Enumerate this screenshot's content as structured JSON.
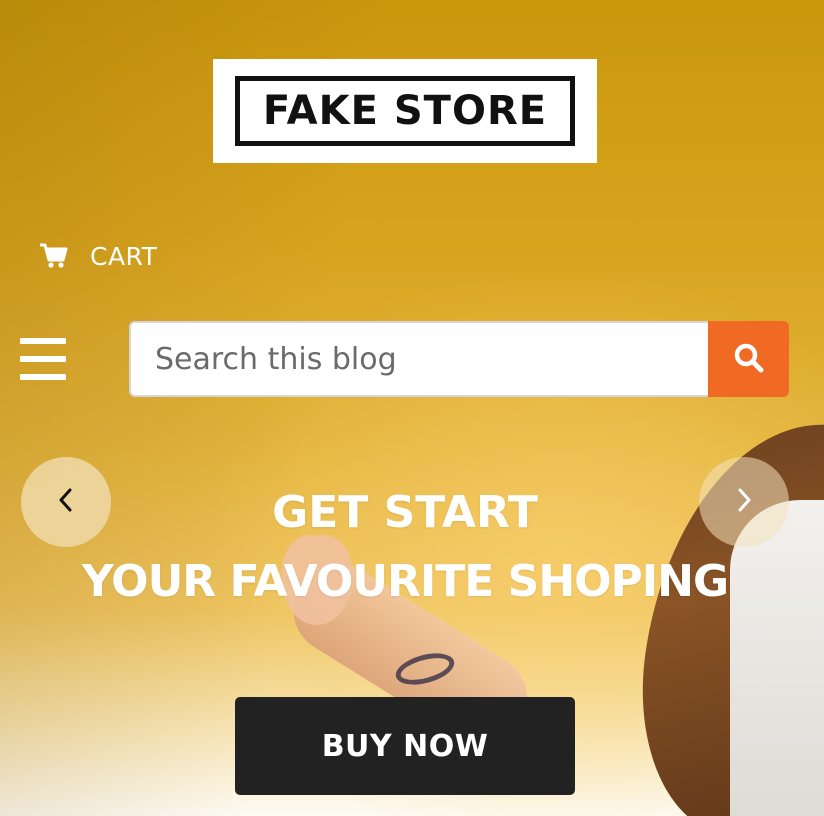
{
  "header": {
    "logo_text": "FAKE STORE",
    "cart_label": "CART"
  },
  "search": {
    "placeholder": "Search this blog",
    "value": ""
  },
  "hero": {
    "headline_line1": "GET START",
    "headline_line2": "YOUR FAVOURITE SHOPING",
    "cta_label": "BUY NOW"
  },
  "icons": {
    "cart": "cart-icon",
    "menu": "hamburger-menu-icon",
    "search": "search-icon",
    "prev": "chevron-left-icon",
    "next": "chevron-right-icon"
  },
  "colors": {
    "accent": "#f06a24",
    "cta_background": "#222222",
    "hero_background": "#d9a21c"
  }
}
